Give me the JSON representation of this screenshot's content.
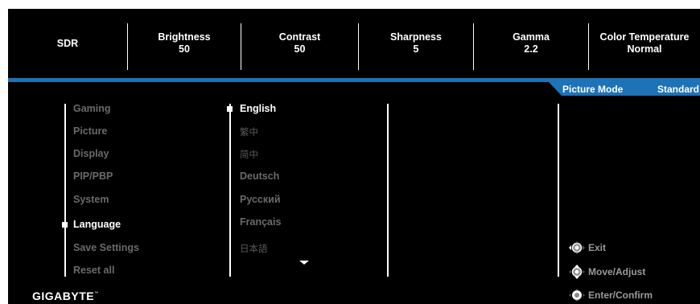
{
  "status_bar": {
    "items": [
      {
        "label": "SDR",
        "value": ""
      },
      {
        "label": "Brightness",
        "value": "50"
      },
      {
        "label": "Contrast",
        "value": "50"
      },
      {
        "label": "Sharpness",
        "value": "5"
      },
      {
        "label": "Gamma",
        "value": "2.2"
      },
      {
        "label": "Color Temperature",
        "value": "Normal"
      }
    ]
  },
  "picture_mode": {
    "label": "Picture Mode",
    "value": "Standard"
  },
  "main_menu": {
    "items": [
      "Gaming",
      "Picture",
      "Display",
      "PIP/PBP",
      "System",
      "Language",
      "Save Settings",
      "Reset all"
    ],
    "selected": "Language"
  },
  "language_menu": {
    "items": [
      "English",
      "繁中",
      "简中",
      "Deutsch",
      "Русский",
      "Français",
      "日本語"
    ],
    "selected": "English"
  },
  "brand": {
    "name": "GIGABYTE",
    "trademark": "™"
  },
  "hints": [
    {
      "label": "Exit",
      "icon": "joystick-left-icon"
    },
    {
      "label": "Move/Adjust",
      "icon": "joystick-up-down-icon"
    },
    {
      "label": "Enter/Confirm",
      "icon": "joystick-press-icon"
    }
  ],
  "colors": {
    "accent": "#1e73b6",
    "background": "#000000",
    "active_text": "#ffffff",
    "inactive_text": "#6a6a6a"
  }
}
